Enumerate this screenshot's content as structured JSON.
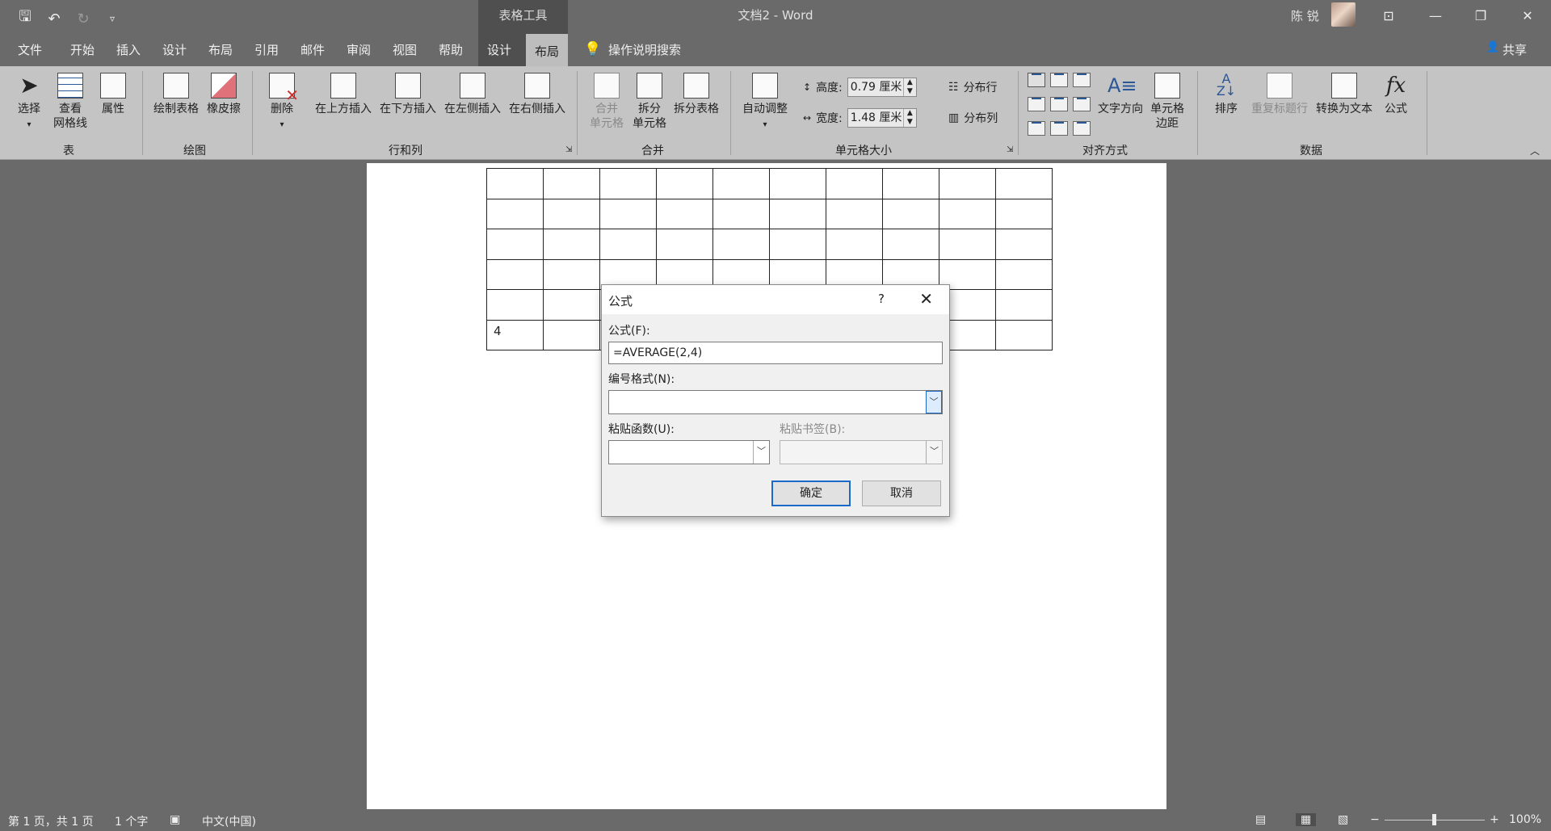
{
  "title_bar": {
    "document_title": "文档2  -  Word",
    "context_group": "表格工具",
    "user_name": "陈 锐",
    "qat": {
      "save_icon": "save-icon",
      "undo_icon": "undo-icon",
      "redo_icon": "redo-icon",
      "customize_icon": "customize-qat-icon"
    },
    "window_buttons": {
      "ribbon_options": "⊡",
      "minimize": "—",
      "restore": "❐",
      "close": "✕"
    }
  },
  "tabs": {
    "file": "文件",
    "home": "开始",
    "insert": "插入",
    "design": "设计",
    "layout": "布局",
    "references": "引用",
    "mailings": "邮件",
    "review": "审阅",
    "view": "视图",
    "help": "帮助",
    "table_design": "设计",
    "table_layout": "布局",
    "tell_me": "操作说明搜索",
    "share": "共享"
  },
  "ribbon": {
    "table_group": {
      "label": "表",
      "select": "选择",
      "view_gridlines_1": "查看",
      "view_gridlines_2": "网格线",
      "properties": "属性"
    },
    "draw_group": {
      "label": "绘图",
      "draw_table": "绘制表格",
      "eraser": "橡皮擦"
    },
    "rows_cols_group": {
      "label": "行和列",
      "delete": "删除",
      "insert_above": "在上方插入",
      "insert_below": "在下方插入",
      "insert_left": "在左侧插入",
      "insert_right": "在右侧插入"
    },
    "merge_group": {
      "label": "合并",
      "merge_1": "合并",
      "merge_2": "单元格",
      "split_1": "拆分",
      "split_2": "单元格",
      "split_table": "拆分表格"
    },
    "cell_size_group": {
      "label": "单元格大小",
      "autofit": "自动调整",
      "height_label": "高度:",
      "height_value": "0.79 厘米",
      "width_label": "宽度:",
      "width_value": "1.48 厘米",
      "distribute_rows": "分布行",
      "distribute_cols": "分布列"
    },
    "alignment_group": {
      "label": "对齐方式",
      "text_direction": "文字方向",
      "cell_margins_1": "单元格",
      "cell_margins_2": "边距"
    },
    "data_group": {
      "label": "数据",
      "sort": "排序",
      "repeat_header": "重复标题行",
      "convert_to_text": "转换为文本",
      "formula": "公式"
    }
  },
  "document": {
    "table_cell_text": "4"
  },
  "dialog": {
    "title": "公式",
    "help": "?",
    "close": "✕",
    "formula_label": "公式(F):",
    "formula_value": "=AVERAGE(2,4)",
    "number_format_label": "编号格式(N):",
    "number_format_value": "",
    "paste_function_label": "粘贴函数(U):",
    "paste_bookmark_label": "粘贴书签(B):",
    "ok": "确定",
    "cancel": "取消"
  },
  "status_bar": {
    "page": "第 1 页，共 1 页",
    "word_count": "1 个字",
    "language": "中文(中国)",
    "zoom": "100%",
    "zoom_out": "−",
    "zoom_in": "+"
  }
}
